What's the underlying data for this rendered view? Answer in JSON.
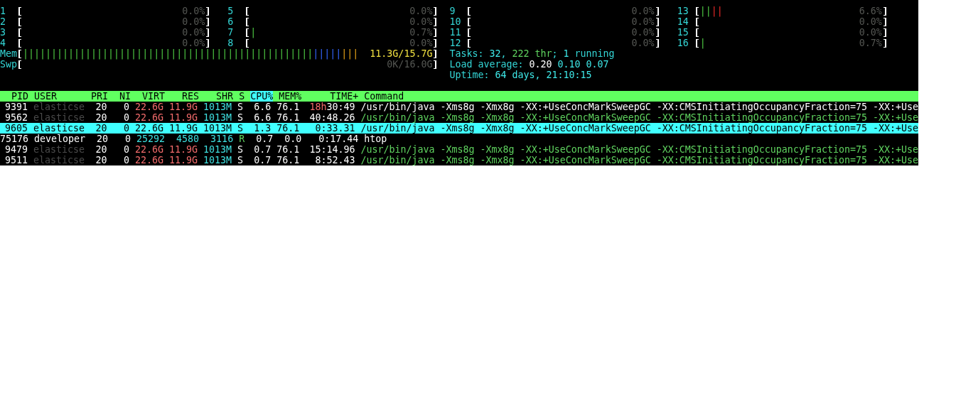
{
  "left_column": {
    "cpus": [
      {
        "label": "1",
        "value": "0.0%"
      },
      {
        "label": "2",
        "value": "0.0%"
      },
      {
        "label": "3",
        "value": "0.0%"
      },
      {
        "label": "4",
        "value": "0.0%"
      },
      {
        "label": "5",
        "value": "0.0%"
      },
      {
        "label": "6",
        "value": "0.0%"
      },
      {
        "label": "7",
        "value": "0.7%",
        "segments": [
          {
            "kind": "normal",
            "bars": "|"
          }
        ]
      },
      {
        "label": "8",
        "value": "0.0%"
      }
    ],
    "memory": [
      {
        "label": "Mem",
        "value": "11.3G/15.7G",
        "kind": "memory",
        "segments": [
          {
            "kind": "used",
            "bars": "|||||||||||||||||||||||||||||||||||||||||||||||||||"
          },
          {
            "kind": "buffers",
            "bars": "|||||"
          },
          {
            "kind": "cache",
            "bars": "|||"
          }
        ]
      },
      {
        "label": "Swp",
        "value": "0K/16.0G",
        "kind": "swap"
      }
    ]
  },
  "right_column": {
    "cpus": [
      {
        "label": "9",
        "value": "0.0%"
      },
      {
        "label": "10",
        "value": "0.0%"
      },
      {
        "label": "11",
        "value": "0.0%"
      },
      {
        "label": "12",
        "value": "0.0%"
      },
      {
        "label": "13",
        "value": "6.6%",
        "segments": [
          {
            "kind": "normal",
            "bars": "||"
          },
          {
            "kind": "kernel",
            "bars": "||"
          }
        ]
      },
      {
        "label": "14",
        "value": "0.0%"
      },
      {
        "label": "15",
        "value": "0.0%"
      },
      {
        "label": "16",
        "value": "0.7%",
        "segments": [
          {
            "kind": "normal",
            "bars": "|"
          }
        ]
      }
    ],
    "stats": [
      {
        "parts": [
          {
            "text": "Tasks: ",
            "kind": "label"
          },
          {
            "text": "32",
            "kind": "value"
          },
          {
            "text": ", ",
            "kind": "label"
          },
          {
            "text": "222 thr",
            "kind": "threads"
          },
          {
            "text": "; ",
            "kind": "label"
          },
          {
            "text": "1",
            "kind": "value"
          },
          {
            "text": " running",
            "kind": "label"
          }
        ]
      },
      {
        "parts": [
          {
            "text": "Load average: ",
            "kind": "label"
          },
          {
            "text": "0.20",
            "kind": "highlight"
          },
          {
            "text": " 0.10",
            "kind": "value"
          },
          {
            "text": " 0.07",
            "kind": "value"
          }
        ]
      },
      {
        "parts": [
          {
            "text": "Uptime: ",
            "kind": "label"
          },
          {
            "text": "64 days, 21:10:15",
            "kind": "value"
          }
        ]
      }
    ]
  },
  "table": {
    "columns": [
      {
        "label": "PID",
        "sorted": false
      },
      {
        "label": "USER",
        "sorted": false
      },
      {
        "label": "PRI",
        "sorted": false
      },
      {
        "label": "NI",
        "sorted": false
      },
      {
        "label": "VIRT",
        "sorted": false
      },
      {
        "label": "RES",
        "sorted": false
      },
      {
        "label": "SHR",
        "sorted": false
      },
      {
        "label": "S",
        "sorted": false
      },
      {
        "label": "CPU%",
        "sorted": true
      },
      {
        "label": "MEM%",
        "sorted": false
      },
      {
        "label": "TIME+",
        "sorted": false
      },
      {
        "label": "Command",
        "sorted": false
      }
    ],
    "rows": [
      {
        "pid": "9391",
        "user": "elasticse",
        "own_user": false,
        "pri": "20",
        "ni": "0",
        "virt": {
          "text": "22.6G",
          "large": true
        },
        "res": {
          "text": "11.9G",
          "large": true
        },
        "shr": {
          "text": "1013M",
          "large": false
        },
        "state": "S",
        "running": false,
        "cpu": "6.6",
        "mem": "76.1",
        "time_hours": "18h",
        "time": "30:49",
        "command": "/usr/bin/java -Xms8g -Xmx8g -XX:+UseConcMarkSweepGC -XX:CMSInitiatingOccupancyFraction=75 -XX:+Use",
        "kind": "process",
        "selected": false
      },
      {
        "pid": "9562",
        "user": "elasticse",
        "own_user": false,
        "pri": "20",
        "ni": "0",
        "virt": {
          "text": "22.6G",
          "large": true
        },
        "res": {
          "text": "11.9G",
          "large": true
        },
        "shr": {
          "text": "1013M",
          "large": false
        },
        "state": "S",
        "running": false,
        "cpu": "6.6",
        "mem": "76.1",
        "time": "40:48.26",
        "command": "/usr/bin/java -Xms8g -Xmx8g -XX:+UseConcMarkSweepGC -XX:CMSInitiatingOccupancyFraction=75 -XX:+Use",
        "kind": "thread",
        "selected": false
      },
      {
        "pid": "9605",
        "user": "elasticse",
        "own_user": false,
        "pri": "20",
        "ni": "0",
        "virt": {
          "text": "22.6G"
        },
        "res": {
          "text": "11.9G"
        },
        "shr": {
          "text": "1013M"
        },
        "state": "S",
        "running": false,
        "cpu": "1.3",
        "mem": "76.1",
        "time": "0:33.31",
        "command": "/usr/bin/java -Xms8g -Xmx8g -XX:+UseConcMarkSweepGC -XX:CMSInitiatingOccupancyFraction=75 -XX:+Use",
        "kind": "thread",
        "selected": true
      },
      {
        "pid": "75176",
        "user": "developer",
        "own_user": true,
        "pri": "20",
        "ni": "0",
        "virt": {
          "text": "25292",
          "large": false
        },
        "res": {
          "text": "4580",
          "large": false
        },
        "shr": {
          "text": "3116",
          "large": false
        },
        "state": "R",
        "running": true,
        "cpu": "0.7",
        "mem": "0.0",
        "time": "0:17.44",
        "command": "htop",
        "kind": "process",
        "selected": false
      },
      {
        "pid": "9479",
        "user": "elasticse",
        "own_user": false,
        "pri": "20",
        "ni": "0",
        "virt": {
          "text": "22.6G",
          "large": true
        },
        "res": {
          "text": "11.9G",
          "large": true
        },
        "shr": {
          "text": "1013M",
          "large": false
        },
        "state": "S",
        "running": false,
        "cpu": "0.7",
        "mem": "76.1",
        "time": "15:14.96",
        "command": "/usr/bin/java -Xms8g -Xmx8g -XX:+UseConcMarkSweepGC -XX:CMSInitiatingOccupancyFraction=75 -XX:+Use",
        "kind": "thread",
        "selected": false
      },
      {
        "pid": "9511",
        "user": "elasticse",
        "own_user": false,
        "pri": "20",
        "ni": "0",
        "virt": {
          "text": "22.6G",
          "large": true
        },
        "res": {
          "text": "11.9G",
          "large": true
        },
        "shr": {
          "text": "1013M",
          "large": false
        },
        "state": "S",
        "running": false,
        "cpu": "0.7",
        "mem": "76.1",
        "time": "8:52.43",
        "command": "/usr/bin/java -Xms8g -Xmx8g -XX:+UseConcMarkSweepGC -XX:CMSInitiatingOccupancyFraction=75 -XX:+Use",
        "kind": "thread",
        "selected": false
      }
    ]
  }
}
